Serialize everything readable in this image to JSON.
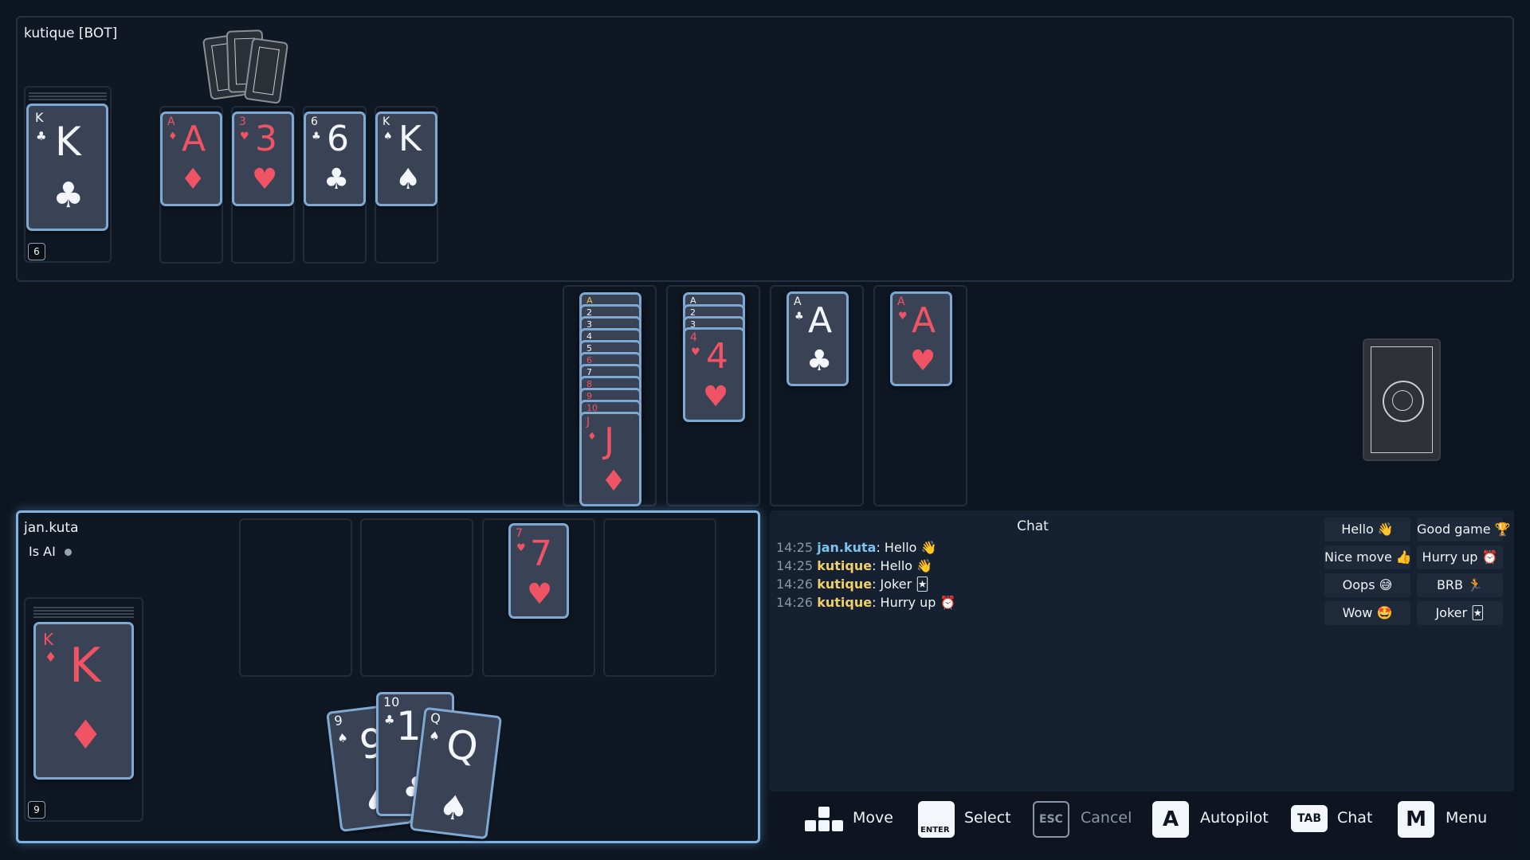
{
  "opponent": {
    "name": "kutique [BOT]",
    "reserve_count": "6",
    "reserve_card": {
      "rank": "K",
      "suit": "♣",
      "color": "white"
    },
    "discard_cards": [
      {
        "rank": "A",
        "suit": "♦",
        "color": "red"
      },
      {
        "rank": "3",
        "suit": "♥",
        "color": "red"
      },
      {
        "rank": "6",
        "suit": "♣",
        "color": "white"
      },
      {
        "rank": "K",
        "suit": "♠",
        "color": "white"
      }
    ]
  },
  "center": {
    "build_piles": [
      {
        "labels": [
          "A",
          "2",
          "3",
          "4",
          "5",
          "6",
          "7",
          "8",
          "9",
          "10"
        ],
        "top": {
          "rank": "J",
          "suit": "♦",
          "color": "red"
        }
      },
      {
        "labels": [
          "A",
          "2",
          "3"
        ],
        "top": {
          "rank": "4",
          "suit": "♥",
          "color": "red"
        }
      },
      {
        "labels": [],
        "top": {
          "rank": "A",
          "suit": "♣",
          "color": "white"
        }
      },
      {
        "labels": [],
        "top": {
          "rank": "A",
          "suit": "♥",
          "color": "red"
        }
      }
    ]
  },
  "player": {
    "name": "jan.kuta",
    "is_ai_label": "Is AI",
    "reserve_count": "9",
    "reserve_card": {
      "rank": "K",
      "suit": "♦",
      "color": "red"
    },
    "discard_cards": [
      null,
      null,
      {
        "rank": "7",
        "suit": "♥",
        "color": "red"
      },
      null
    ],
    "hand": [
      {
        "rank": "9",
        "suit": "♠",
        "color": "white"
      },
      {
        "rank": "10",
        "suit": "♣",
        "color": "white"
      },
      {
        "rank": "Q",
        "suit": "♠",
        "color": "white"
      }
    ]
  },
  "chat": {
    "title": "Chat",
    "messages": [
      {
        "time": "14:25",
        "user": "jan.kuta",
        "text": ": Hello 👋",
        "self": true
      },
      {
        "time": "14:25",
        "user": "kutique",
        "text": ": Hello 👋",
        "self": false
      },
      {
        "time": "14:26",
        "user": "kutique",
        "text": ": Joker 🃏",
        "self": false
      },
      {
        "time": "14:26",
        "user": "kutique",
        "text": ": Hurry up ⏰",
        "self": false
      }
    ],
    "quick": [
      "Hello 👋",
      "Good game 🏆",
      "Nice move 👍",
      "Hurry up ⏰",
      "Oops 😅",
      "BRB 🏃",
      "Wow 🤩",
      "Joker 🃏"
    ]
  },
  "controls": {
    "move": "Move",
    "select_key": "ENTER",
    "select": "Select",
    "cancel_key": "ESC",
    "cancel": "Cancel",
    "autopilot_key": "A",
    "autopilot": "Autopilot",
    "chat_key": "TAB",
    "chat": "Chat",
    "menu_key": "M",
    "menu": "Menu"
  },
  "colors": {
    "red": "#f05464",
    "white": "#f3f6fb",
    "accent": "#7fb3e0"
  }
}
